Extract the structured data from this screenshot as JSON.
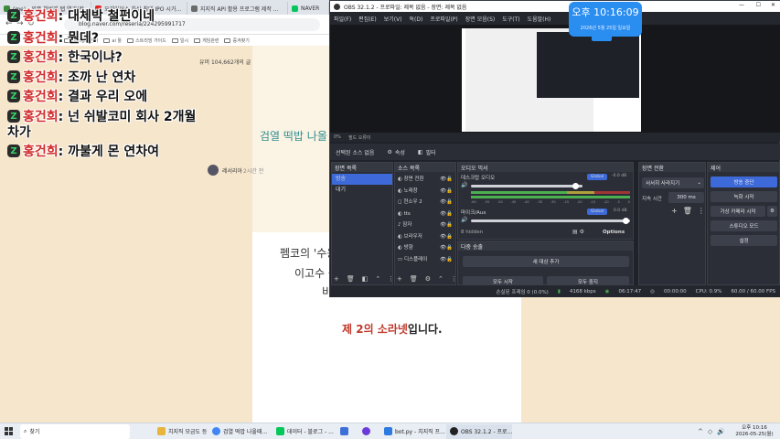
{
  "browser": {
    "tabs": [
      {
        "label": "(me) - 왼쪽 첫번째 탭 열기(전...",
        "color": "#3c8b3c"
      },
      {
        "label": "오레커어스 차살 최대 IPO 시가...",
        "color": "#e02424"
      },
      {
        "label": "지지직 API 활용 프로그램 제작 ...",
        "color": "#6a6a6a"
      },
      {
        "label": "NAVER",
        "color": "#03c75a"
      }
    ],
    "url": "blog.naver.com/reseria/224295991717",
    "bookmarks": [
      "Google 번역",
      "ai 툴",
      "스트리밍 가이드",
      "일시",
      "게임관련",
      "증겨찾기"
    ],
    "post_view_count": "유머 104,662개의 글",
    "post_title_partial": "검열 떡밥 나올",
    "author": "레서리아",
    "time_ago": "2시간 전",
    "body_lines": [
      "펨코의 '수용",
      "이고수 등 '",
      "비"
    ],
    "highlight_red": "제 2의 소라넷",
    "highlight_rest": "입니다."
  },
  "chat": [
    {
      "name": "홍건희",
      "msg": " : 대체박 철펀이네"
    },
    {
      "name": "홍건희",
      "msg": " : 뭔데?"
    },
    {
      "name": "홍건희",
      "msg": " : 한국이냐?"
    },
    {
      "name": "홍건희",
      "msg": " : 조까 난 연차"
    },
    {
      "name": "홍건희",
      "msg": " : 결과 우리 오에"
    },
    {
      "name": "홍건희",
      "msg": " : 넌 쉬발코미 회사 2개월"
    },
    {
      "name": "",
      "msg": "차가"
    },
    {
      "name": "홍건희",
      "msg": " : 까불게 몬 연차여"
    }
  ],
  "chat_badge": "Z",
  "obs": {
    "title": "OBS 32.1.2 - 프로파일: 제목 없음 - 장면: 제목 없음",
    "menu": [
      "파일(F)",
      "편집(E)",
      "보기(V)",
      "독(D)",
      "프로파일(P)",
      "장면 모음(S)",
      "도구(T)",
      "도움말(H)"
    ],
    "preview_controls": [
      "0%",
      "필드 오류이"
    ],
    "src_bar": {
      "no_source": "선택된 소스 없음",
      "properties": "속성",
      "filters": "필터"
    },
    "docks": {
      "scenes": {
        "title": "장면 목록",
        "items": [
          "방송",
          "대기"
        ]
      },
      "sources": {
        "title": "소스 목록",
        "items": [
          "장면 전환",
          "노래창",
          "현소우 2",
          "tts",
          "잠자",
          "브라우저",
          "방향",
          "디스플레이"
        ]
      },
      "mixer": {
        "title": "오디오 믹서",
        "tracks": [
          {
            "name": "데스크탑 오디오",
            "tag": "Global",
            "db": "-0.0 dB"
          },
          {
            "name": "마이크/Aux",
            "tag": "Global",
            "db": "0.0 dB"
          }
        ],
        "hidden": "8 hidden",
        "options": "Options",
        "scale": [
          "-60",
          "-55",
          "-50",
          "-45",
          "-40",
          "-35",
          "-30",
          "-25",
          "-20",
          "-15",
          "-10",
          "-5",
          "0"
        ]
      },
      "transitions": {
        "title": "장면 전환",
        "type": "서서히 사라지기",
        "duration_label": "지속 시간",
        "duration": "300 ms"
      },
      "controls": {
        "title": "제어",
        "buttons": [
          "방송 중단",
          "녹화 시작",
          "가상 카메라 시작",
          "스튜디오 모드",
          "설정"
        ]
      },
      "multi": {
        "title": "다중 송출",
        "add": "새 대상 추가",
        "start_all": "모두 시작",
        "stop_all": "모두 중지"
      }
    },
    "status": {
      "dropped": "손실된 프레임 0 (0.0%)",
      "bitrate": "4168 kbps",
      "live_time": "06:17:47",
      "rec_time": "00:00:00",
      "cpu": "CPU: 0.9%",
      "fps": "60.00 / 60.00 FPS"
    }
  },
  "clock": {
    "time": "오후 10:16:09",
    "sub": "2026년 5월 25일 일요일"
  },
  "taskbar": {
    "search": "찾기",
    "apps": [
      {
        "label": "치지직 모금도 등",
        "color": "#e8b53c"
      },
      {
        "label": "검열 떡밥 나올때...",
        "color": "#4285f4"
      },
      {
        "label": "데이터 - 블로그 - ...",
        "color": "#03c75a"
      },
      {
        "label": "",
        "color": "#3d6fd9"
      },
      {
        "label": "",
        "color": "#6b3ad9"
      },
      {
        "label": "bot.py - 치지직 프...",
        "color": "#2d7be0"
      },
      {
        "label": "OBS 32.1.2 - 프로...",
        "color": "#222"
      }
    ],
    "time": "오후 10:16",
    "date": "2026-05-25(월)"
  }
}
